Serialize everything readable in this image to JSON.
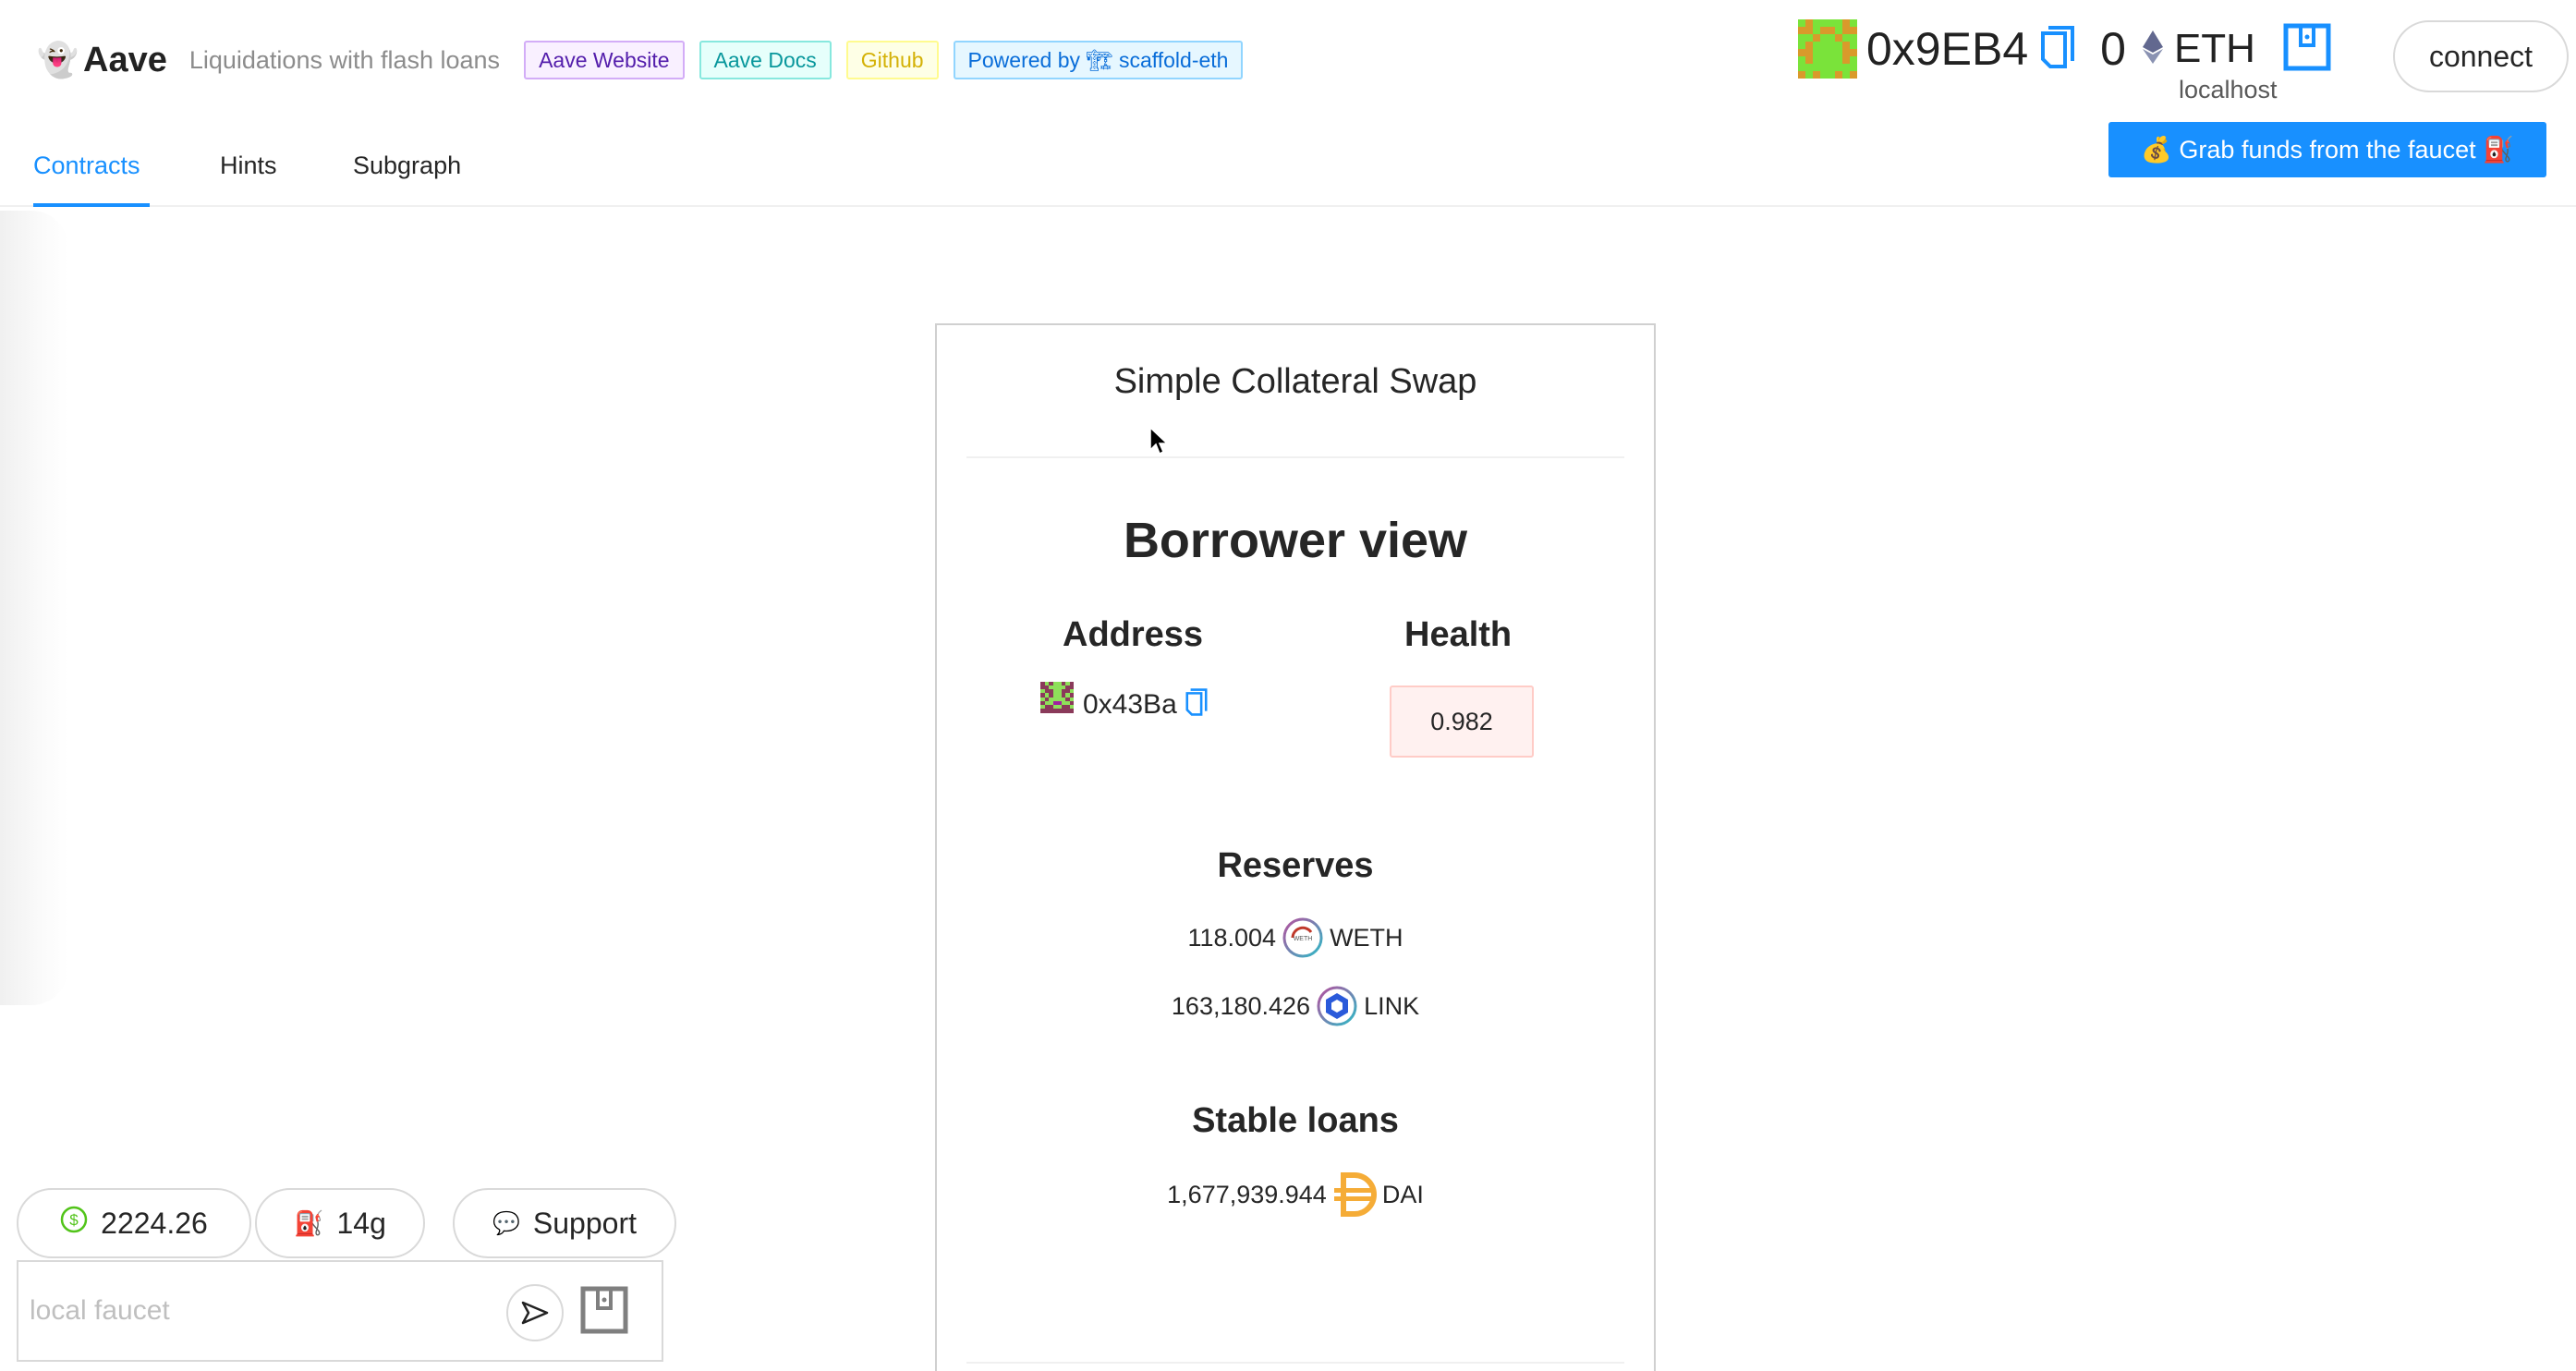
{
  "header": {
    "logo_emoji": "👻",
    "title": "Aave",
    "subtitle": "Liquidations with flash loans",
    "tags": [
      {
        "label": "Aave Website",
        "color": "purple"
      },
      {
        "label": "Aave Docs",
        "color": "cyan"
      },
      {
        "label": "Github",
        "color": "gold"
      },
      {
        "label": "Powered by 🏗 scaffold-eth",
        "color": "blue"
      }
    ]
  },
  "tabs": [
    {
      "label": "Contracts",
      "active": true
    },
    {
      "label": "Hints",
      "active": false
    },
    {
      "label": "Subgraph",
      "active": false
    }
  ],
  "account": {
    "address": "0x9EB4",
    "balance": "0",
    "currency": "ETH",
    "network": "localhost",
    "connect_label": "connect",
    "faucet_button": "💰 Grab funds from the faucet ⛽️",
    "blockie_colors": [
      "#7ae33a",
      "#d99a2b"
    ]
  },
  "card": {
    "title": "Simple Collateral Swap",
    "view_title": "Borrower view",
    "address_heading": "Address",
    "health_heading": "Health",
    "borrower_address": "0x43Ba",
    "health_value": "0.982",
    "reserves_heading": "Reserves",
    "reserves": [
      {
        "amount": "118.004",
        "symbol": "WETH",
        "icon": "weth-token-icon"
      },
      {
        "amount": "163,180.426",
        "symbol": "LINK",
        "icon": "link-token-icon"
      }
    ],
    "stable_loans_heading": "Stable loans",
    "stable_loans": [
      {
        "amount": "1,677,939.944",
        "symbol": "DAI",
        "icon": "dai-token-icon"
      }
    ]
  },
  "footer": {
    "eth_price": "2224.26",
    "gas_price": "14g",
    "support_label": "Support",
    "faucet_placeholder": "local faucet",
    "gas_emoji": "⛽️",
    "support_emoji": "💬"
  },
  "colors": {
    "accent": "#1890ff",
    "health_bg": "#fff1f0",
    "health_border": "#ffccc7",
    "dai": "#f5ac37",
    "link": "#2a5ada"
  }
}
